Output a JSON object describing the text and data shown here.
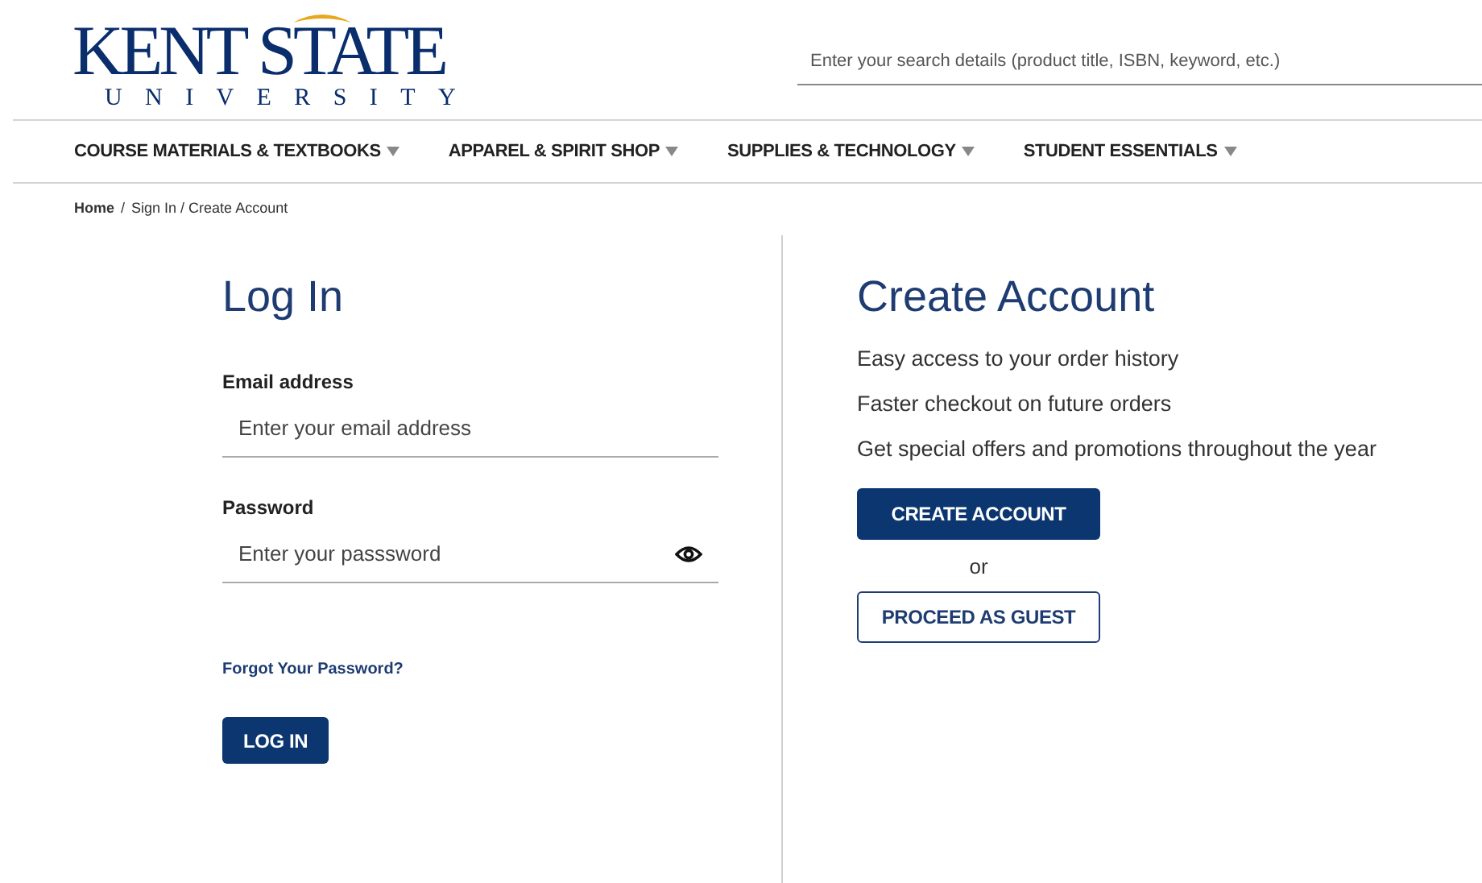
{
  "logo": {
    "name": "KENT STATE",
    "subtitle": "UNIVERSITY"
  },
  "search": {
    "placeholder": "Enter your search details (product title, ISBN, keyword, etc.)"
  },
  "nav": [
    {
      "label": "COURSE MATERIALS & TEXTBOOKS"
    },
    {
      "label": "APPAREL & SPIRIT SHOP"
    },
    {
      "label": "SUPPLIES & TECHNOLOGY"
    },
    {
      "label": "STUDENT ESSENTIALS"
    }
  ],
  "breadcrumb": {
    "separator": "/",
    "items": [
      {
        "label": "Home",
        "kind": "link"
      },
      {
        "label": "Sign In / Create Account",
        "kind": "current"
      }
    ]
  },
  "login": {
    "title": "Log In",
    "fields": [
      {
        "kind": "email",
        "label": "Email address",
        "placeholder": "Enter your email address"
      },
      {
        "kind": "password",
        "label": "Password",
        "placeholder": "Enter your passsword"
      }
    ],
    "forgot": "Forgot Your Password?",
    "button": "LOG IN"
  },
  "create": {
    "title": "Create Account",
    "benefits": [
      "Easy access to your order history",
      "Faster checkout on future orders",
      "Get special offers and promotions throughout the year"
    ],
    "primary": "CREATE ACCOUNT",
    "or": "or",
    "secondary": "PROCEED AS GUEST"
  }
}
